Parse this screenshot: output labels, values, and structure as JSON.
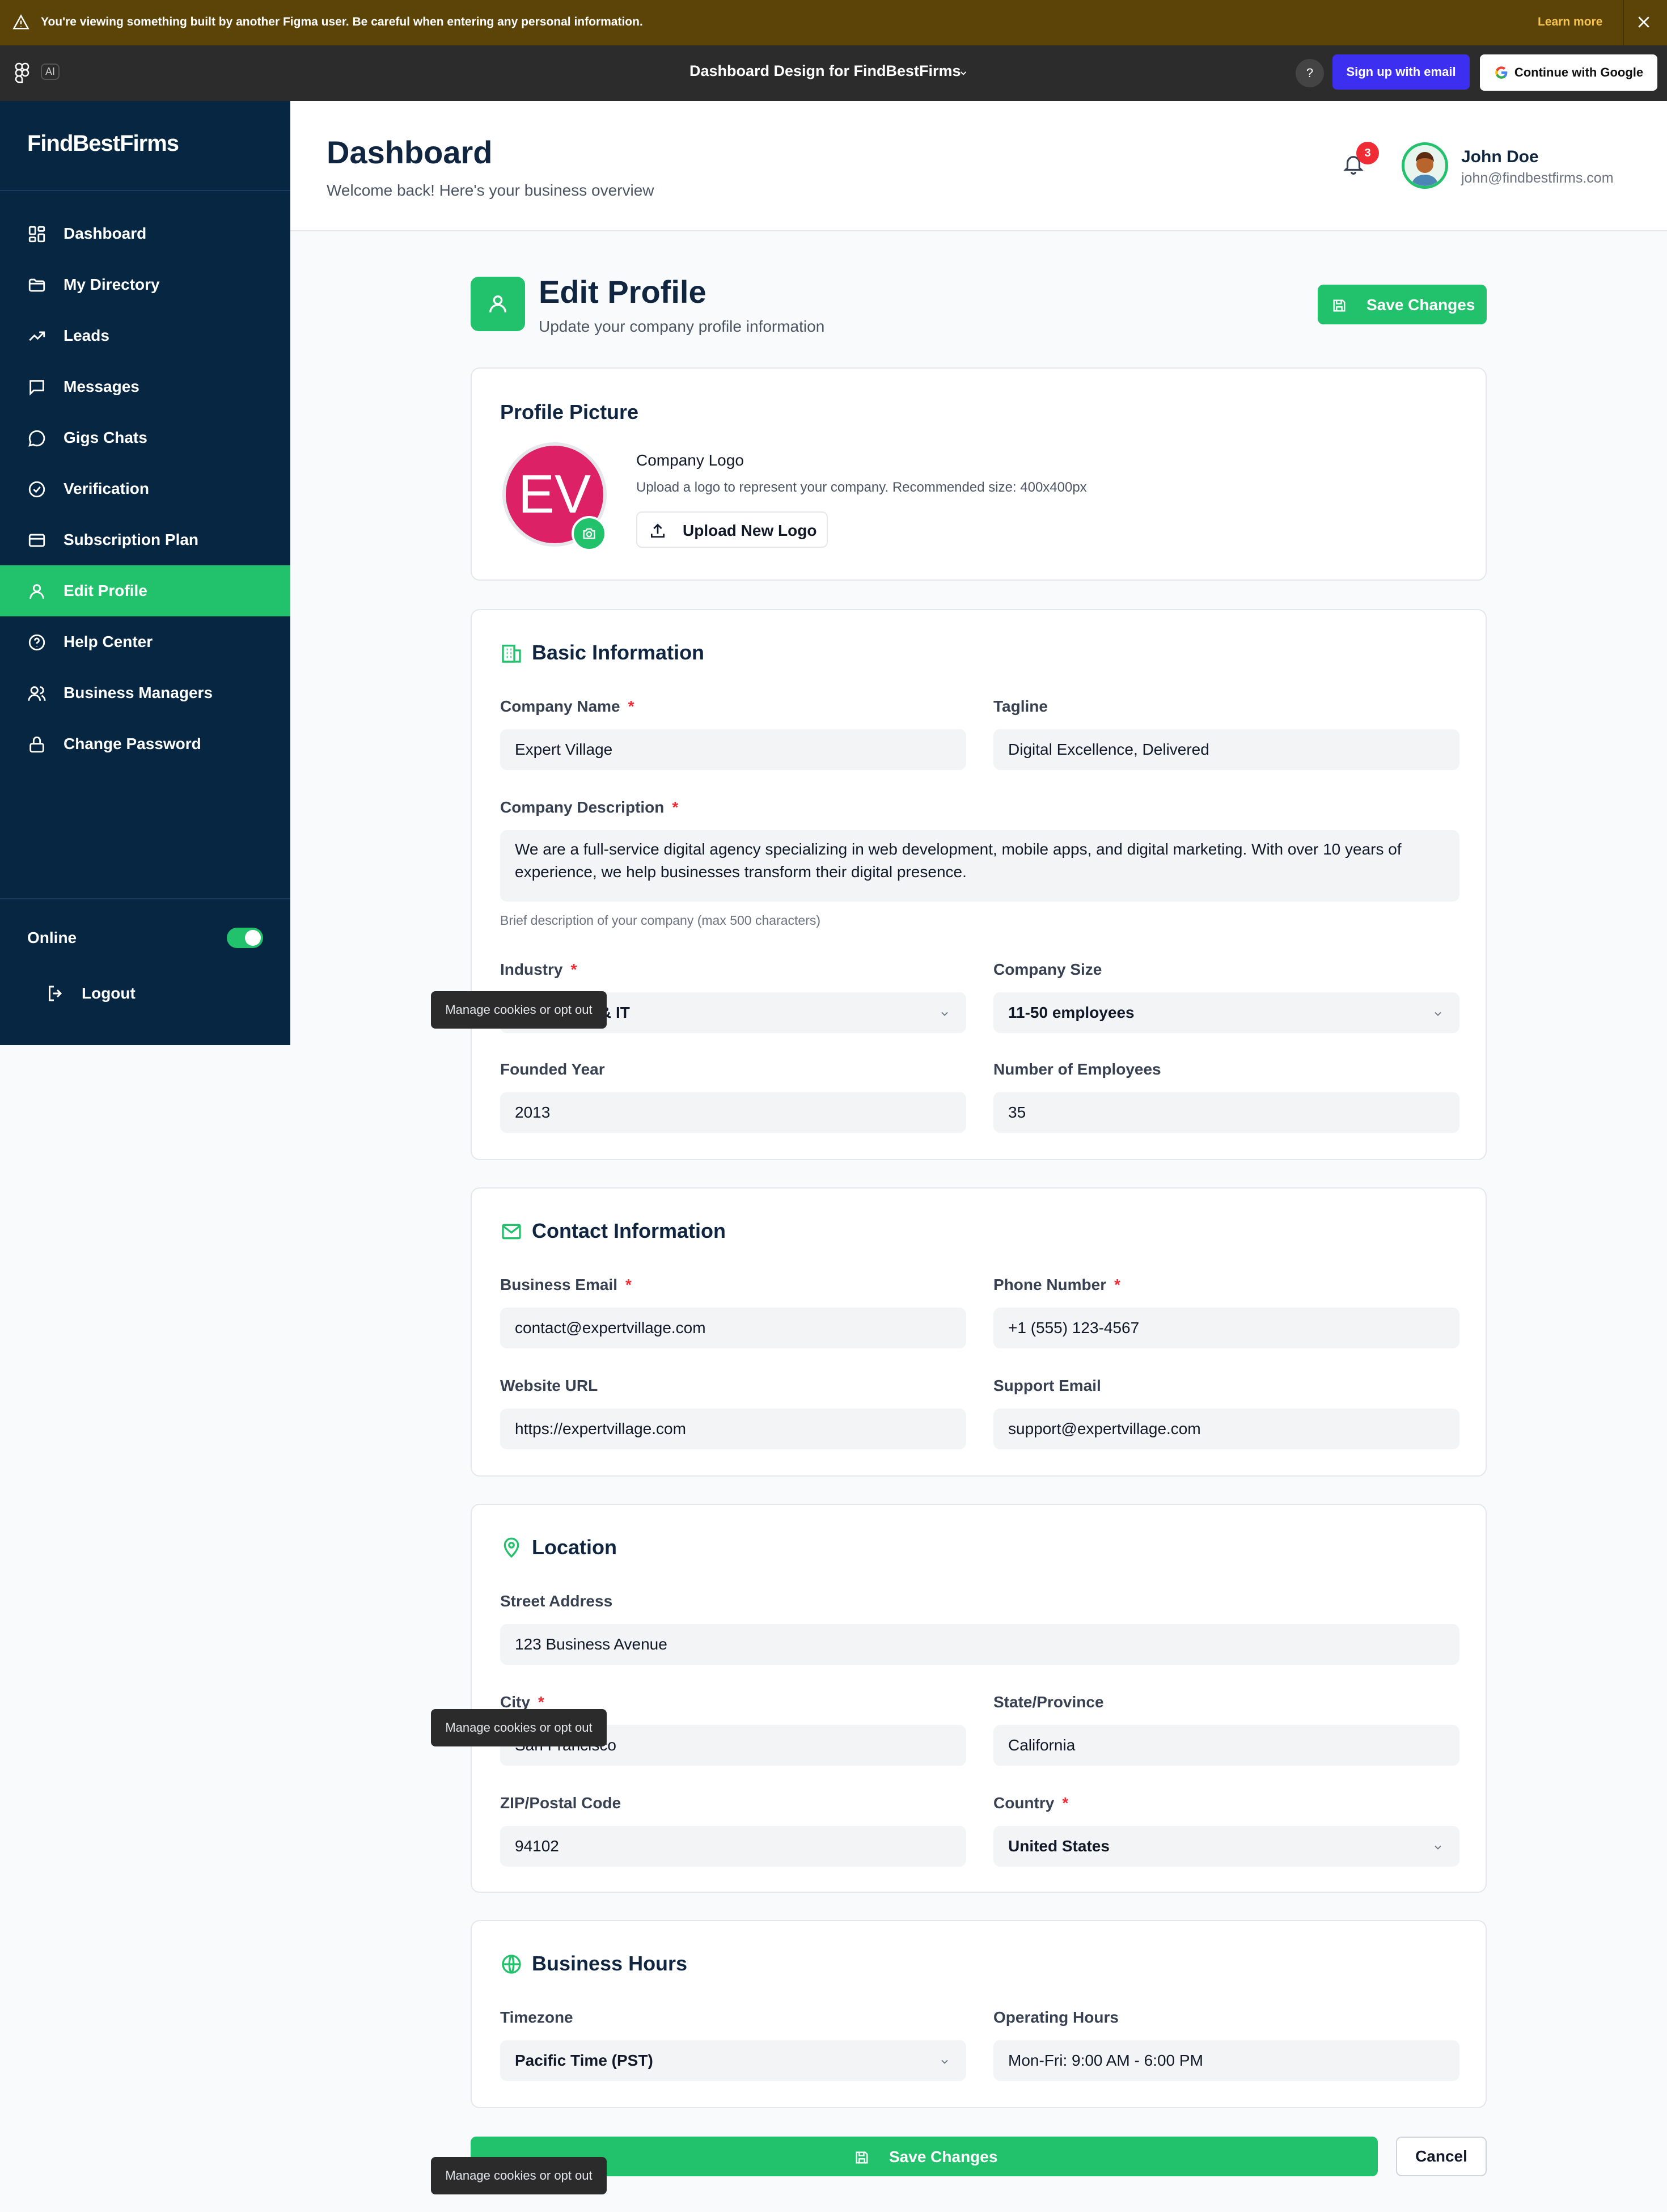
{
  "figma_banner": {
    "warning_text": "You're viewing something built by another Figma user. Be careful when entering any personal information.",
    "learn_more": "Learn more"
  },
  "figma_toolbar": {
    "ai_label": "AI",
    "file_title": "Dashboard Design for FindBestFirms",
    "help_label": "?",
    "signup_label": "Sign up with email",
    "google_label": "Continue with Google"
  },
  "sidebar": {
    "brand": "FindBestFirms",
    "items": [
      {
        "label": "Dashboard",
        "icon": "dashboard-icon"
      },
      {
        "label": "My Directory",
        "icon": "folder-icon"
      },
      {
        "label": "Leads",
        "icon": "trend-icon"
      },
      {
        "label": "Messages",
        "icon": "message-icon"
      },
      {
        "label": "Gigs Chats",
        "icon": "chat-icon"
      },
      {
        "label": "Verification",
        "icon": "check-circle-icon"
      },
      {
        "label": "Subscription Plan",
        "icon": "card-icon"
      },
      {
        "label": "Edit Profile",
        "icon": "user-icon",
        "active": true
      },
      {
        "label": "Help Center",
        "icon": "help-circle-icon"
      },
      {
        "label": "Business Managers",
        "icon": "users-icon"
      },
      {
        "label": "Change Password",
        "icon": "lock-icon"
      }
    ],
    "online_label": "Online",
    "online_on": true,
    "logout_label": "Logout"
  },
  "header": {
    "title": "Dashboard",
    "subtitle": "Welcome back! Here's your business overview",
    "notification_count": "3",
    "user_name": "John Doe",
    "user_email": "john@findbestfirms.com"
  },
  "page": {
    "title": "Edit Profile",
    "subtitle": "Update your company profile information",
    "save_label": "Save Changes",
    "cancel_label": "Cancel"
  },
  "profile_picture": {
    "title": "Profile Picture",
    "initials": "EV",
    "logo_heading": "Company Logo",
    "logo_help": "Upload a logo to represent your company. Recommended size: 400x400px",
    "upload_label": "Upload New Logo"
  },
  "basic": {
    "title": "Basic Information",
    "company_name_label": "Company Name",
    "company_name": "Expert Village",
    "tagline_label": "Tagline",
    "tagline": "Digital Excellence, Delivered",
    "description_label": "Company Description",
    "description": "We are a full-service digital agency specializing in web development, mobile apps, and digital marketing. With over 10 years of experience, we help businesses transform their digital presence.",
    "description_help": "Brief description of your company (max 500 characters)",
    "industry_label": "Industry",
    "industry": "& IT",
    "company_size_label": "Company Size",
    "company_size": "11-50 employees",
    "founded_label": "Founded Year",
    "founded": "2013",
    "employees_label": "Number of Employees",
    "employees": "35"
  },
  "contact": {
    "title": "Contact Information",
    "email_label": "Business Email",
    "email": "contact@expertvillage.com",
    "phone_label": "Phone Number",
    "phone": "+1 (555) 123-4567",
    "website_label": "Website URL",
    "website": "https://expertvillage.com",
    "support_label": "Support Email",
    "support": "support@expertvillage.com"
  },
  "location": {
    "title": "Location",
    "street_label": "Street Address",
    "street": "123 Business Avenue",
    "city_label": "City",
    "city": "San Francisco",
    "state_label": "State/Province",
    "state": "California",
    "zip_label": "ZIP/Postal Code",
    "zip": "94102",
    "country_label": "Country",
    "country": "United States"
  },
  "hours": {
    "title": "Business Hours",
    "timezone_label": "Timezone",
    "timezone": "Pacific Time (PST)",
    "operating_label": "Operating Hours",
    "operating": "Mon-Fri: 9:00 AM - 6:00 PM"
  },
  "cookie_tooltip": "Manage cookies or opt out",
  "colors": {
    "accent": "#22c16b",
    "sidebar": "#062642",
    "required": "#ef2b36",
    "avatar_bg": "#dd2166",
    "figma_banner": "#5c4308"
  }
}
